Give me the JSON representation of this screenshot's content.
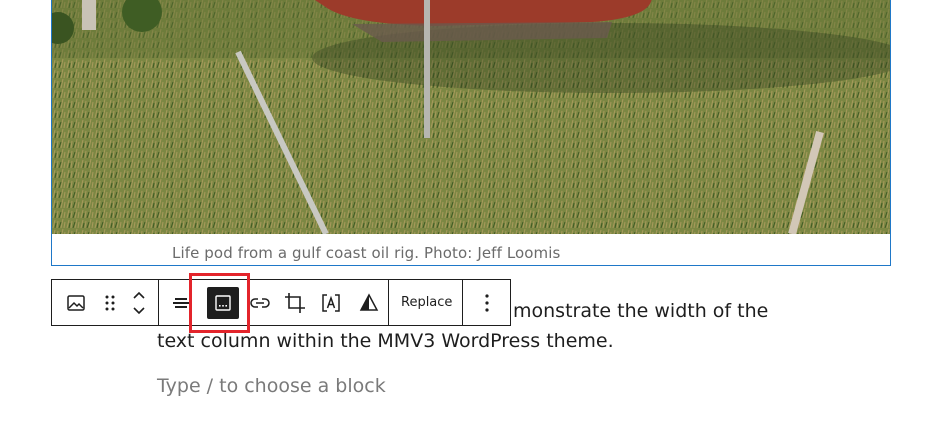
{
  "image_block": {
    "caption": "Life pod from a gulf coast oil rig. Photo: Jeff Loomis"
  },
  "toolbar": {
    "block_type_icon": "image-icon",
    "drag_icon": "drag-handle-icon",
    "move_icon": "chevron-up-down-icon",
    "align_icon": "align-icon",
    "caption_icon": "caption-icon",
    "link_icon": "link-icon",
    "crop_icon": "crop-icon",
    "text_overlay_icon": "text-overlay-icon",
    "duotone_icon": "duotone-icon",
    "replace_label": "Replace",
    "more_icon": "more-vertical-icon"
  },
  "paragraph": {
    "line1": "monstrate the width of the",
    "line2": "text column within the MMV3 WordPress theme."
  },
  "new_block": {
    "placeholder": "Type / to choose a block"
  },
  "colors": {
    "selection_border": "#1f78c8",
    "highlight": "#e3242b",
    "toolbar_text": "#1e1e1e"
  }
}
